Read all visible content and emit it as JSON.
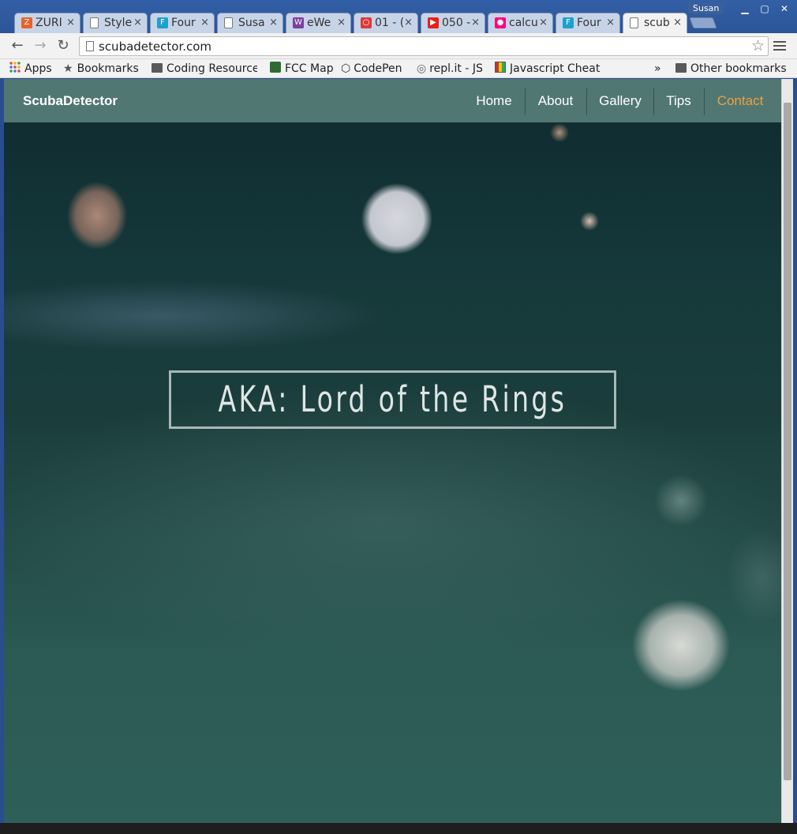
{
  "browser": {
    "tabs": [
      {
        "title": "ZURI",
        "favicon_color": "#e8622c",
        "favicon_glyph": "Z"
      },
      {
        "title": "Style",
        "favicon_color": "#ffffff",
        "favicon_glyph": ""
      },
      {
        "title": "Four",
        "favicon_color": "#1ea1c9",
        "favicon_glyph": "F"
      },
      {
        "title": "Susa",
        "favicon_color": "#ffffff",
        "favicon_glyph": ""
      },
      {
        "title": "eWe",
        "favicon_color": "#7b3fa0",
        "favicon_glyph": "W"
      },
      {
        "title": "01 - (",
        "favicon_color": "#d93b3b",
        "favicon_glyph": "○"
      },
      {
        "title": "050 -",
        "favicon_color": "#e62117",
        "favicon_glyph": "▶"
      },
      {
        "title": "calcu",
        "favicon_color": "#ff0084",
        "favicon_glyph": "●"
      },
      {
        "title": "Four",
        "favicon_color": "#1ea1c9",
        "favicon_glyph": "F"
      },
      {
        "title": "scub",
        "favicon_color": "#ffffff",
        "favicon_glyph": "",
        "active": true
      }
    ],
    "profile_name": "Susan",
    "close_glyph": "×",
    "url": "scubadetector.com",
    "bookmarks": [
      {
        "label": "Apps",
        "icon": "apps-grid-icon"
      },
      {
        "label": "Bookmarks",
        "icon": "star-icon"
      },
      {
        "label": "Coding Resource",
        "icon": "folder-icon"
      },
      {
        "label": "FCC Map",
        "icon": "fcc-icon"
      },
      {
        "label": "CodePen",
        "icon": "codepen-icon"
      },
      {
        "label": "repl.it - JS",
        "icon": "replit-icon"
      },
      {
        "label": "Javascript Cheat",
        "icon": "cheatsheet-icon"
      }
    ],
    "overflow_glyph": "»",
    "other_bookmarks": "Other bookmarks"
  },
  "site": {
    "brand": "ScubaDetector",
    "nav": [
      "Home",
      "About",
      "Gallery",
      "Tips",
      "Contact"
    ],
    "active_color": "#e8a33c",
    "headline": "AKA: Lord of the Rings"
  }
}
